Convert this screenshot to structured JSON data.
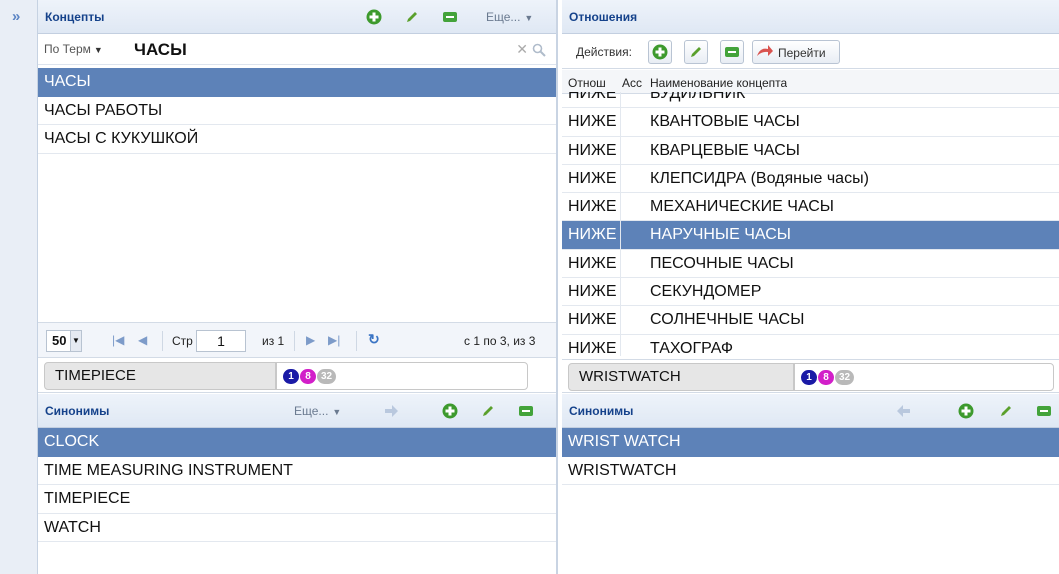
{
  "concepts": {
    "title": "Концепты",
    "more_label": "Еще...",
    "search": {
      "mode": "По Терм",
      "query": "ЧАСЫ"
    },
    "items": [
      "ЧАСЫ",
      "ЧАСЫ РАБОТЫ",
      "ЧАСЫ С КУКУШКОЙ"
    ],
    "selected_index": 0,
    "pager": {
      "page_size": "50",
      "page_label": "Стр",
      "page": "1",
      "of_label": "из 1",
      "summary": "с 1 по 3, из 3"
    },
    "term": "TIMEPIECE",
    "badges": [
      "1",
      "8",
      "32"
    ]
  },
  "concept_synonyms": {
    "title": "Синонимы",
    "more_label": "Еще...",
    "items": [
      "CLOCK",
      "TIME MEASURING INSTRUMENT",
      "TIMEPIECE",
      "WATCH"
    ],
    "selected_index": 0
  },
  "relations": {
    "title": "Отношения",
    "actions_label": "Действия:",
    "goto_label": "Перейти",
    "columns": [
      "Отнош",
      "Асс",
      "Наименование концепта"
    ],
    "rows": [
      {
        "rel": "НИЖЕ",
        "name": "БУДИЛЬНИК"
      },
      {
        "rel": "НИЖЕ",
        "name": "КВАНТОВЫЕ ЧАСЫ"
      },
      {
        "rel": "НИЖЕ",
        "name": "КВАРЦЕВЫЕ ЧАСЫ"
      },
      {
        "rel": "НИЖЕ",
        "name": "КЛЕПСИДРА (Водяные часы)"
      },
      {
        "rel": "НИЖЕ",
        "name": "МЕХАНИЧЕСКИЕ ЧАСЫ"
      },
      {
        "rel": "НИЖЕ",
        "name": "НАРУЧНЫЕ ЧАСЫ"
      },
      {
        "rel": "НИЖЕ",
        "name": "ПЕСОЧНЫЕ ЧАСЫ"
      },
      {
        "rel": "НИЖЕ",
        "name": "СЕКУНДОМЕР"
      },
      {
        "rel": "НИЖЕ",
        "name": "СОЛНЕЧНЫЕ ЧАСЫ"
      },
      {
        "rel": "НИЖЕ",
        "name": "ТАХОГРАФ"
      }
    ],
    "selected_index": 5,
    "term": "WRISTWATCH",
    "badges": [
      "1",
      "8",
      "32"
    ]
  },
  "relation_synonyms": {
    "title": "Синонимы",
    "items": [
      "WRIST WATCH",
      "WRISTWATCH"
    ],
    "selected_index": 0
  },
  "colors": {
    "header_text": "#15428b",
    "selection": "#5d82b8",
    "badge_1": "#1a1aa6",
    "badge_2": "#d21fc9",
    "badge_3": "#b9b9b9",
    "add_icon": "#3d9a2d",
    "edit_icon": "#5aa02c",
    "remove_icon": "#43a33a"
  }
}
